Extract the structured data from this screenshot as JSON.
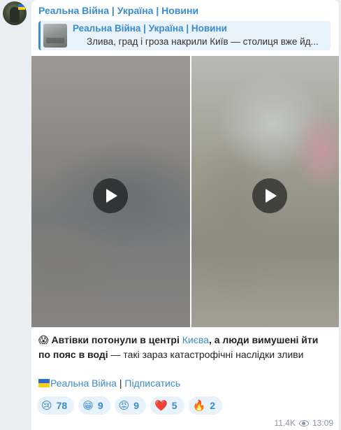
{
  "channel": {
    "name": "Реальна Війна | Україна | Новини"
  },
  "reply": {
    "title": "Реальна Війна | Україна | Новини",
    "text": "Злива, град і гроза накрили Київ — столиця вже йд..."
  },
  "videos": [
    {
      "label": "video-1"
    },
    {
      "label": "video-2"
    }
  ],
  "caption": {
    "emoji": "😱",
    "bold_1": "Автівки потонули в центрі ",
    "link": "Києва",
    "bold_2": ", а люди вимушені йти по пояс в воді",
    "rest": " — такі зараз катастрофічні наслідки зливи"
  },
  "footer": {
    "channel_link": "Реальна Війна",
    "separator": " | ",
    "subscribe_link": "Підписатись"
  },
  "reactions": [
    {
      "emoji": "😢",
      "count": "78"
    },
    {
      "emoji": "😁",
      "count": "9"
    },
    {
      "emoji": "😡",
      "count": "9"
    },
    {
      "emoji": "❤️",
      "count": "5"
    },
    {
      "emoji": "🔥",
      "count": "2"
    }
  ],
  "meta": {
    "views": "11.4K",
    "time": "13:09"
  },
  "colors": {
    "accent": "#3a8bd0",
    "background": "#e9eef3",
    "bubble": "#ffffff"
  }
}
